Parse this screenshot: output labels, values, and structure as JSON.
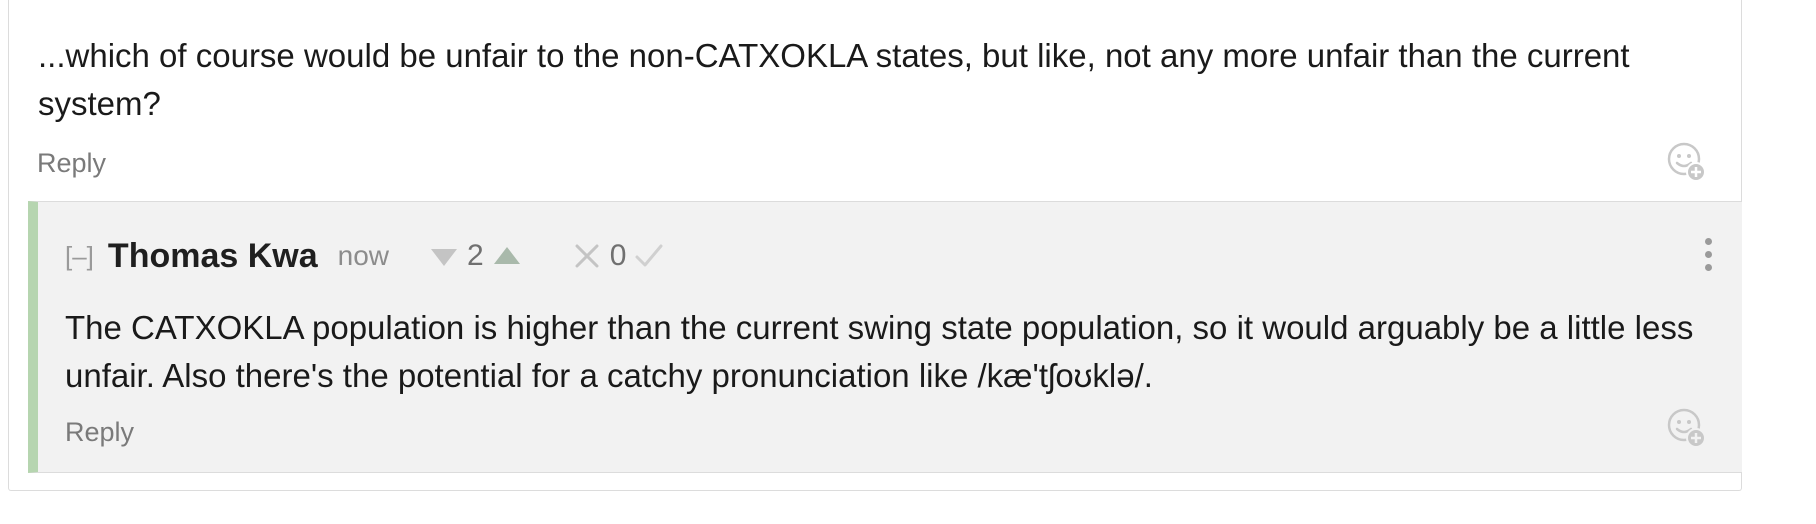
{
  "parent_comment": {
    "body": "...which of course would be unfair to the non-CATXOKLA states, but like, not any more unfair than the current system?",
    "reply_label": "Reply",
    "react_icon": "add-reaction-icon"
  },
  "reply_comment": {
    "collapse_label": "[–]",
    "author": "Thomas Kwa",
    "timestamp": "now",
    "karma_score": "2",
    "agreement_score": "0",
    "body": "The CATXOKLA population is higher than the current swing state population, so it would arguably be a little less unfair. Also there's the potential for a catchy pronunciation like /kæ'tʃoʊklə/.",
    "reply_label": "Reply",
    "react_icon": "add-reaction-icon",
    "menu_icon": "vertical-dots-icon"
  },
  "colors": {
    "thread_bar": "#b6d5b0",
    "reply_background": "#f2f2f2",
    "muted_text": "#7a7a7a",
    "icon_gray": "#b3b3b3"
  }
}
